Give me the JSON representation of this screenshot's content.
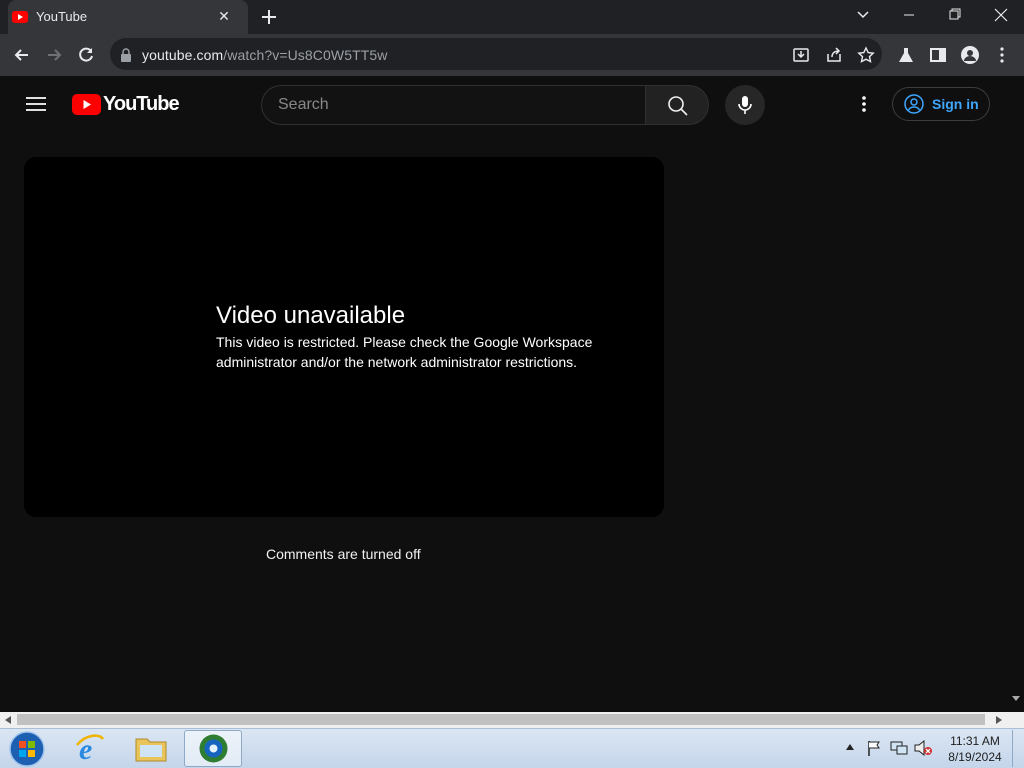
{
  "browser": {
    "tab_title": "YouTube",
    "url_host": "youtube.com",
    "url_path": "/watch?v=Us8C0W5TT5w"
  },
  "youtube": {
    "logo_text": "YouTube",
    "search_placeholder": "Search",
    "signin_label": "Sign in"
  },
  "player": {
    "error_title": "Video unavailable",
    "error_message": "This video is restricted. Please check the Google Workspace administrator and/or the network administrator restrictions."
  },
  "comments_status": "Comments are turned off",
  "taskbar": {
    "time": "11:31 AM",
    "date": "8/19/2024"
  },
  "colors": {
    "yt_red": "#ff0000",
    "link_blue": "#3ea6ff",
    "background": "#0f0f0f"
  }
}
